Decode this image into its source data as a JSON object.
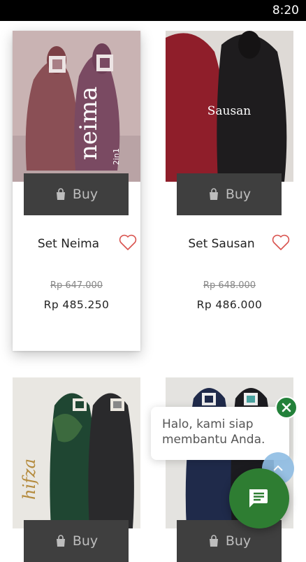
{
  "status_bar": {
    "time": "8:20"
  },
  "products": [
    {
      "name": "Set Neima",
      "old_price": "Rp 647.000",
      "price": "Rp 485.250",
      "buy_label": "Buy",
      "photo_text_1": "neima",
      "photo_text_2": "2in1"
    },
    {
      "name": "Set Sausan",
      "old_price": "Rp 648.000",
      "price": "Rp 486.000",
      "buy_label": "Buy",
      "photo_text_1": "Sausan"
    },
    {
      "buy_label": "Buy",
      "photo_text_1": "hifza"
    },
    {
      "buy_label": "Buy"
    }
  ],
  "chat": {
    "greeting": "Halo, kami siap membantu Anda."
  },
  "colors": {
    "buy_bg": "#3f3f3f",
    "chat_green": "#2e7d32",
    "heart": "#d9534f"
  },
  "icons": {
    "bag": "shopping-bag-icon",
    "heart": "heart-outline-icon",
    "chat": "chat-icon",
    "close": "close-icon",
    "up": "arrow-up-icon"
  }
}
